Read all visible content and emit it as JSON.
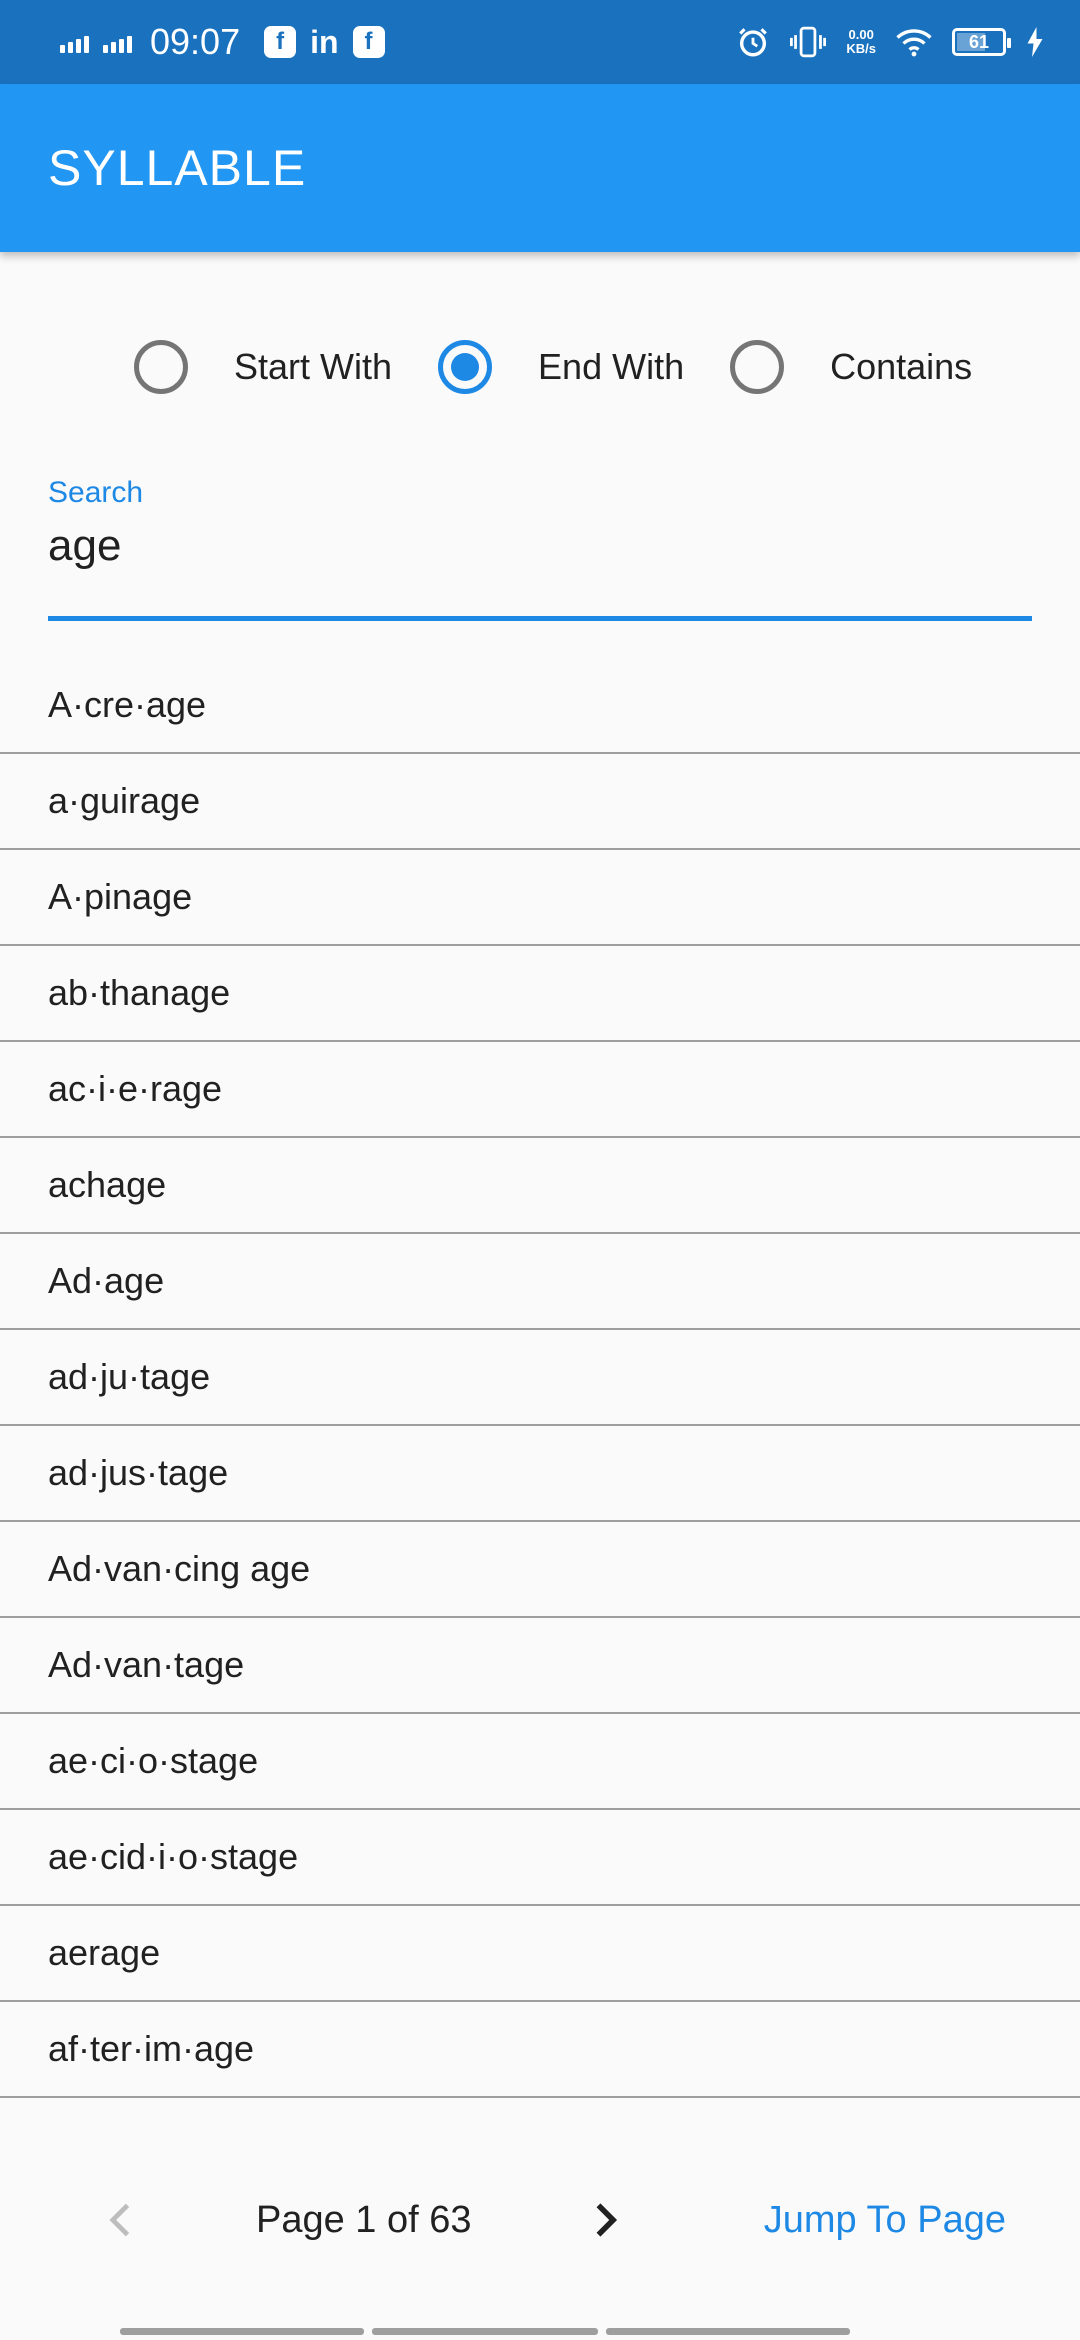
{
  "status_bar": {
    "time": "09:07",
    "network_speed_value": "0.00",
    "network_speed_unit": "KB/s",
    "battery": "61",
    "icons": [
      "signal-icon",
      "signal-icon",
      "facebook-icon",
      "linkedin-icon",
      "facebook-icon",
      "alarm-icon",
      "vibrate-icon",
      "wifi-icon",
      "battery-icon",
      "charging-icon"
    ]
  },
  "app_bar": {
    "title": "SYLLABLE"
  },
  "filter": {
    "options": [
      {
        "label": "Start With",
        "selected": false
      },
      {
        "label": "End With",
        "selected": true
      },
      {
        "label": "Contains",
        "selected": false
      }
    ]
  },
  "search": {
    "label": "Search",
    "value": "age"
  },
  "words": [
    "A·cre·age",
    "a·guirage",
    "A·pinage",
    "ab·thanage",
    "ac·i·e·rage",
    "achage",
    "Ad·age",
    "ad·ju·tage",
    "ad·jus·tage",
    "Ad·van·cing age",
    "Ad·van·tage",
    "ae·ci·o·stage",
    "ae·cid·i·o·stage",
    "aerage",
    "af·ter·im·age"
  ],
  "pagination": {
    "page_text": "Page 1 of 63",
    "jump_label": "Jump To Page",
    "prev_enabled": false,
    "next_enabled": true
  },
  "colors": {
    "status_bar": "#1A72BF",
    "app_bar": "#2196F3",
    "accent": "#1E88E5"
  }
}
